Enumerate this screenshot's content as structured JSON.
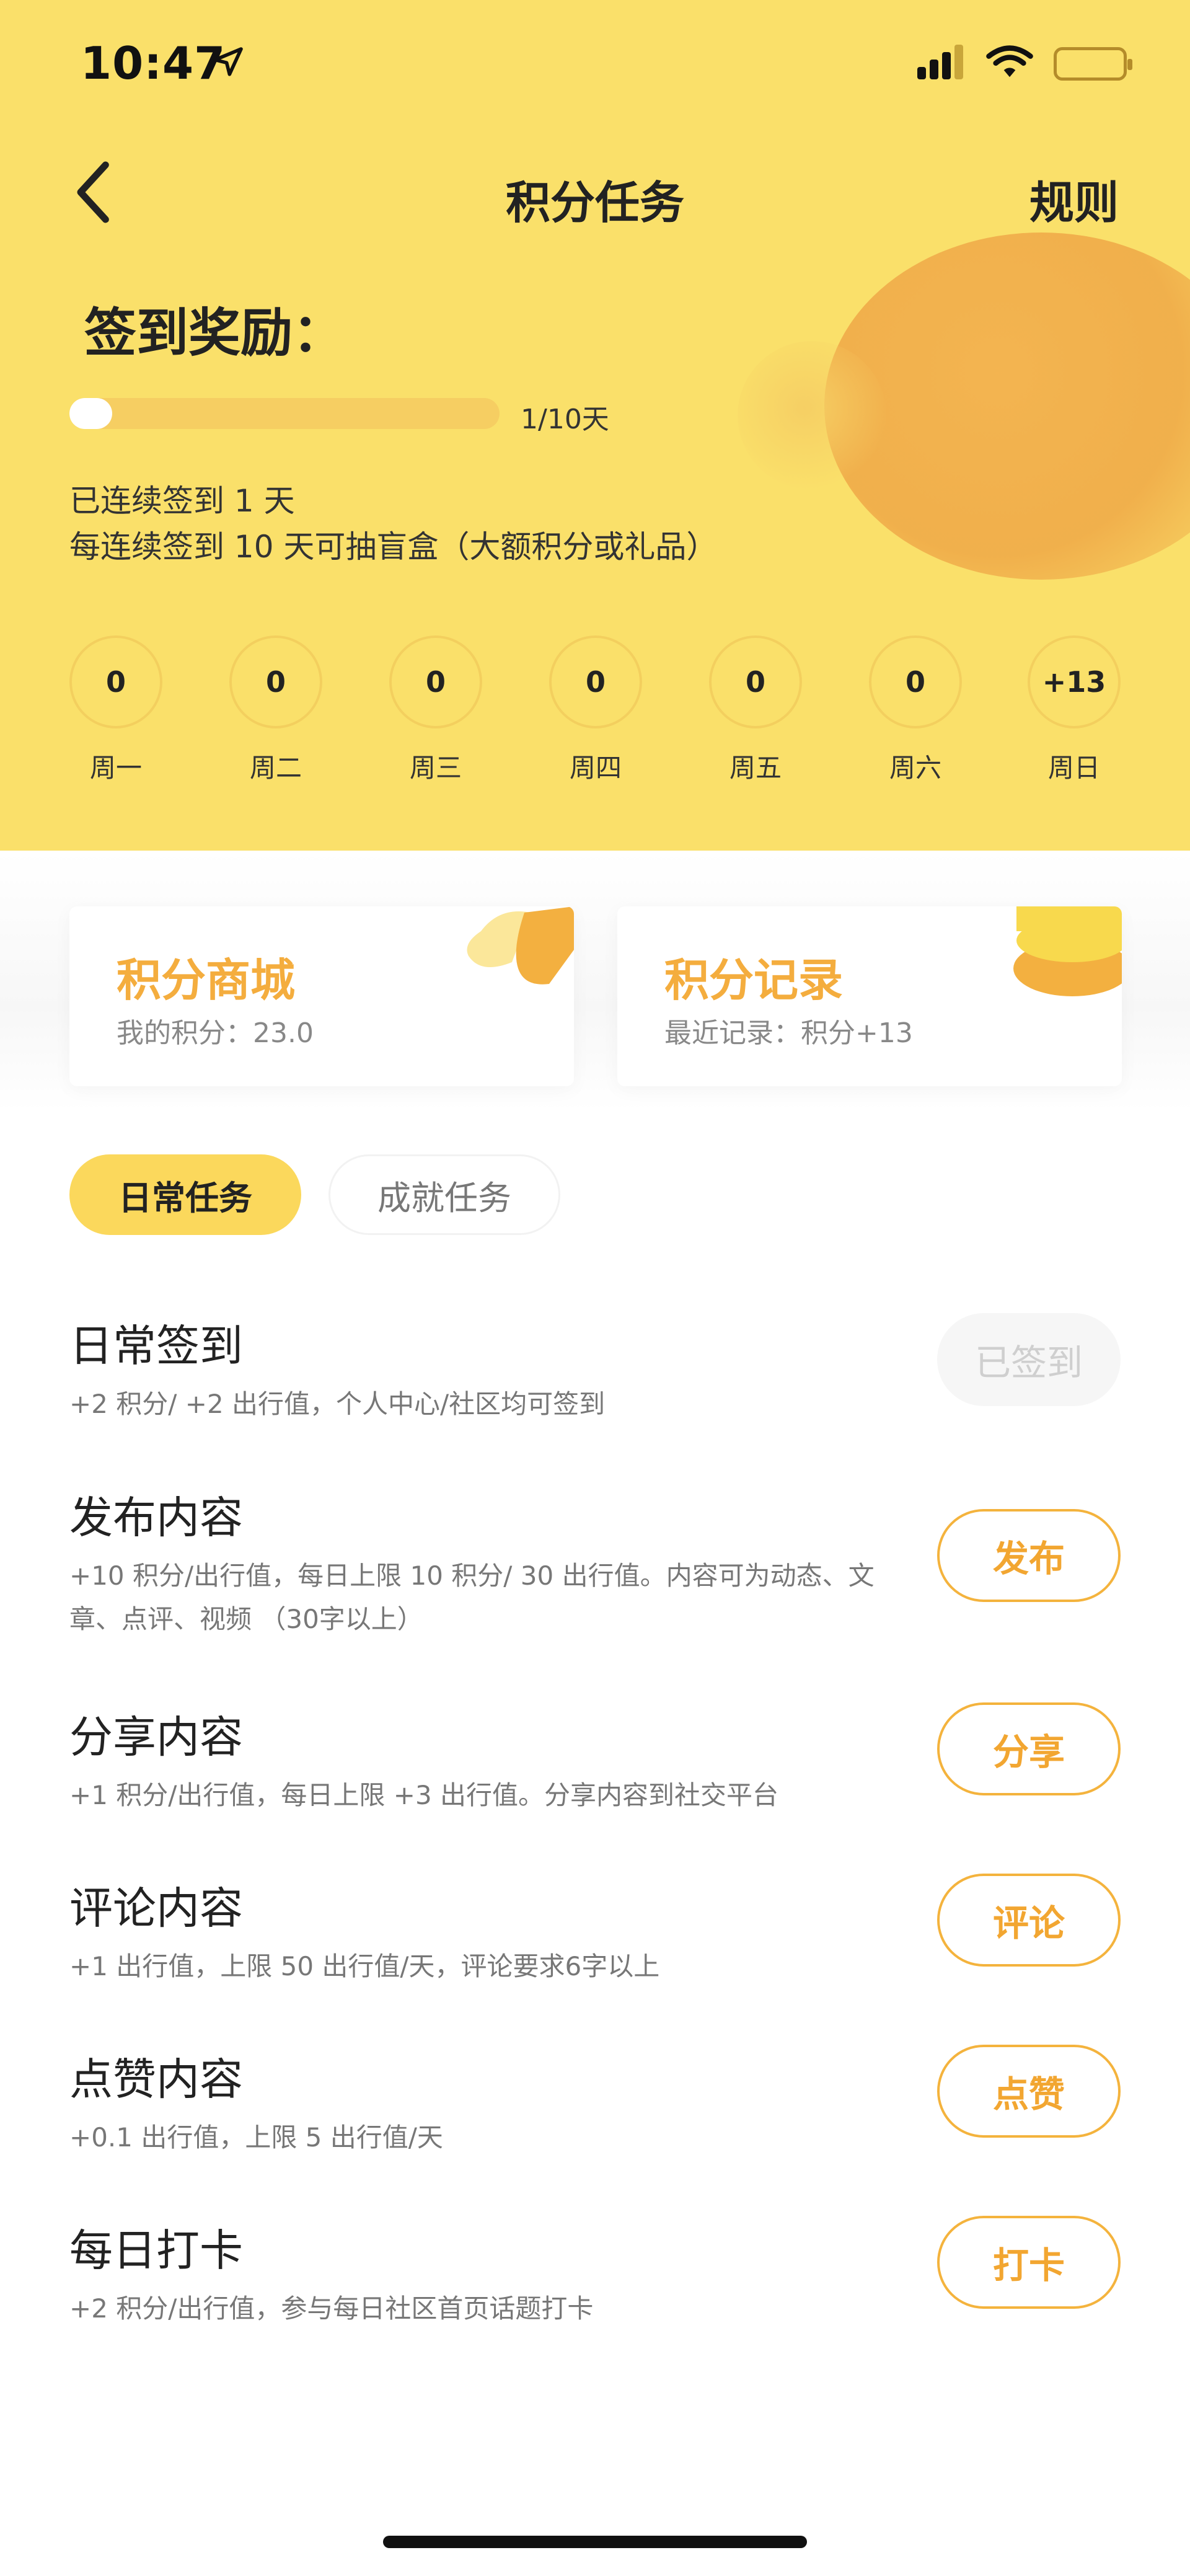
{
  "status_bar": {
    "time": "10:47"
  },
  "nav": {
    "title": "积分任务",
    "rules": "规则"
  },
  "checkin": {
    "title": "签到奖励：",
    "progress_text": "1/10天",
    "progress_value": 0.1,
    "streak_text": "已连续签到 1 天",
    "reward_text": "每连续签到 10 天可抽盲盒（大额积分或礼品）",
    "days": [
      {
        "value": "0",
        "label": "周一"
      },
      {
        "value": "0",
        "label": "周二"
      },
      {
        "value": "0",
        "label": "周三"
      },
      {
        "value": "0",
        "label": "周四"
      },
      {
        "value": "0",
        "label": "周五"
      },
      {
        "value": "0",
        "label": "周六"
      },
      {
        "value": "+13",
        "label": "周日"
      }
    ]
  },
  "cards": {
    "mall": {
      "title": "积分商城",
      "subtitle": "我的积分：23.0"
    },
    "record": {
      "title": "积分记录",
      "subtitle": "最近记录：积分+13"
    }
  },
  "tabs": [
    {
      "label": "日常任务",
      "active": true
    },
    {
      "label": "成就任务",
      "active": false
    }
  ],
  "tasks": [
    {
      "title": "日常签到",
      "desc": "+2 积分/ +2 出行值，个人中心/社区均可签到",
      "button": "已签到",
      "done": true
    },
    {
      "title": "发布内容",
      "desc": "+10 积分/出行值，每日上限 10 积分/ 30 出行值。内容可为动态、文章、点评、视频 （30字以上）",
      "button": "发布",
      "done": false
    },
    {
      "title": "分享内容",
      "desc": "+1 积分/出行值，每日上限 +3 出行值。分享内容到社交平台",
      "button": "分享",
      "done": false
    },
    {
      "title": "评论内容",
      "desc": "+1 出行值，上限 50 出行值/天，评论要求6字以上",
      "button": "评论",
      "done": false
    },
    {
      "title": "点赞内容",
      "desc": "+0.1 出行值，上限 5 出行值/天",
      "button": "点赞",
      "done": false
    },
    {
      "title": "每日打卡",
      "desc": "+2 积分/出行值，参与每日社区首页话题打卡",
      "button": "打卡",
      "done": false
    }
  ],
  "colors": {
    "header_bg": "#fae06a",
    "accent": "#f4ad3e",
    "tab_active_bg": "#fbd85c"
  }
}
